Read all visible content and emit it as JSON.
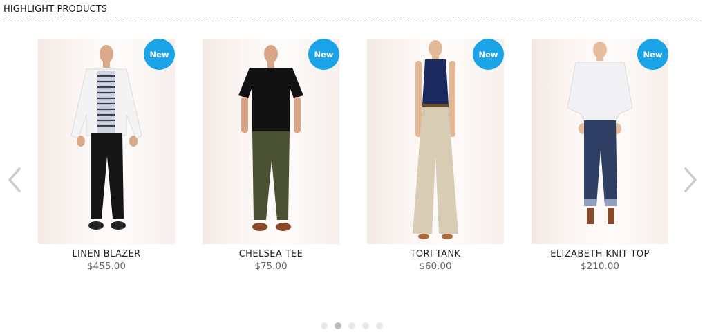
{
  "section": {
    "title": "HIGHLIGHT PRODUCTS"
  },
  "products": [
    {
      "name": "LINEN BLAZER",
      "price": "$455.00",
      "badge": "New"
    },
    {
      "name": "CHELSEA TEE",
      "price": "$75.00",
      "badge": "New"
    },
    {
      "name": "TORI TANK",
      "price": "$60.00",
      "badge": "New"
    },
    {
      "name": "ELIZABETH KNIT TOP",
      "price": "$210.00",
      "badge": "New"
    }
  ],
  "carousel": {
    "pages": 5,
    "active_page": 2
  },
  "colors": {
    "badge": "#1aa3e6",
    "arrow": "#cccccc",
    "dot": "#e8e8e8",
    "dot_active": "#bdbdbd"
  }
}
